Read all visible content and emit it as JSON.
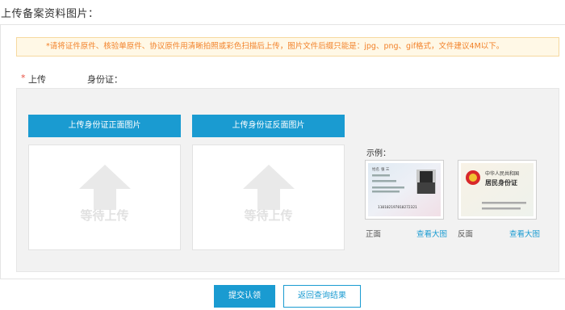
{
  "page": {
    "title": "上传备案资料图片："
  },
  "notice": {
    "text": "*请将证件原件、核验单原件、协议原件用清晰拍照或彩色扫描后上传，图片文件后缀只能是：jpg、png、gif格式，文件建议4M以下。"
  },
  "field": {
    "required_mark": "*",
    "upload_label": "上传",
    "idcard_label": "身份证："
  },
  "upload": {
    "front_button": "上传身份证正面图片",
    "back_button": "上传身份证反面图片",
    "placeholder": "等待上传"
  },
  "example": {
    "label": "示例：",
    "front_caption": "正面",
    "back_caption": "反面",
    "view_large": "查看大图",
    "front_card": {
      "name_label": "姓名",
      "name": "张 三",
      "id_number": "110102197810272321"
    },
    "back_card": {
      "country": "中华人民共和国",
      "title": "居民身份证"
    }
  },
  "actions": {
    "submit": "提交认领",
    "back": "返回查询结果"
  },
  "colors": {
    "accent": "#1a9bd1",
    "notice_text": "#f2822a",
    "notice_bg": "#fff8e6",
    "required": "#e84e40"
  }
}
